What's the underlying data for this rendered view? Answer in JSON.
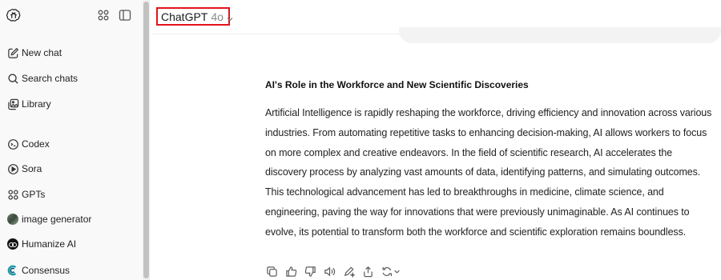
{
  "sidebar": {
    "items": [
      {
        "label": "New chat",
        "icon": "new-chat-icon"
      },
      {
        "label": "Search chats",
        "icon": "search-icon"
      },
      {
        "label": "Library",
        "icon": "library-icon"
      },
      {
        "label": "Codex",
        "icon": "codex-icon"
      },
      {
        "label": "Sora",
        "icon": "sora-icon"
      },
      {
        "label": "GPTs",
        "icon": "gpts-grid-icon"
      },
      {
        "label": "image generator",
        "icon": "image-generator-avatar"
      },
      {
        "label": "Humanize AI",
        "icon": "humanize-ai-avatar"
      },
      {
        "label": "Consensus",
        "icon": "consensus-icon"
      }
    ]
  },
  "header": {
    "model_name": "ChatGPT",
    "model_version": "4o"
  },
  "message": {
    "title": "AI's Role in the Workforce and New Scientific Discoveries",
    "body": "Artificial Intelligence is rapidly reshaping the workforce, driving efficiency and innovation across various industries. From automating repetitive tasks to enhancing decision-making, AI allows workers to focus on more complex and creative endeavors. In the field of scientific research, AI accelerates the discovery process by analyzing vast amounts of data, identifying patterns, and simulating outcomes. This technological advancement has led to breakthroughs in medicine, climate science, and engineering, paving the way for innovations that were previously unimaginable. As AI continues to evolve, its potential to transform both the workforce and scientific exploration remains boundless."
  },
  "actions": [
    "copy-icon",
    "thumbs-up-icon",
    "thumbs-down-icon",
    "read-aloud-icon",
    "edit-canvas-icon",
    "share-icon",
    "regenerate-icon"
  ],
  "colors": {
    "highlight": "#e3141b",
    "sidebar_bg": "#f9f9f9"
  }
}
